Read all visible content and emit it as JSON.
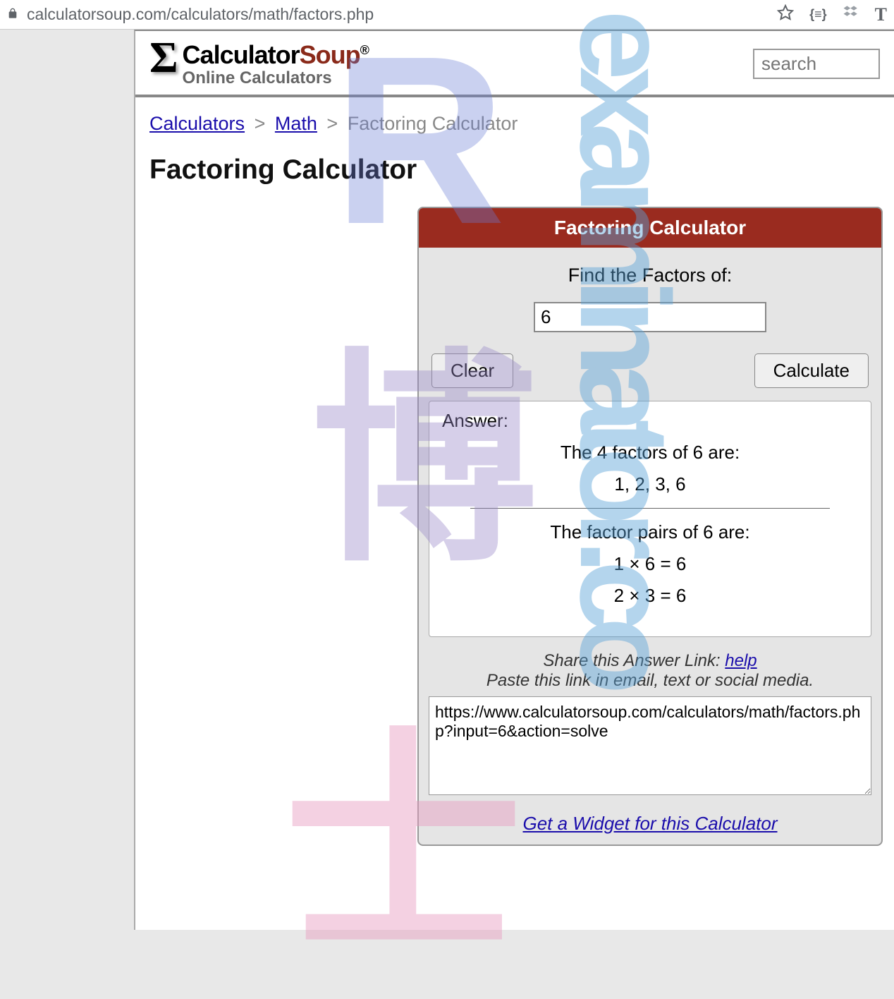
{
  "browser": {
    "url": "calculatorsoup.com/calculators/math/factors.php"
  },
  "header": {
    "brand_calc": "Calculator",
    "brand_soup": "Soup",
    "brand_reg": "®",
    "brand_sub": "Online Calculators",
    "search_placeholder": "search"
  },
  "breadcrumbs": {
    "item1": "Calculators",
    "sep": ">",
    "item2": "Math",
    "current": "Factoring Calculator"
  },
  "page": {
    "title": "Factoring Calculator"
  },
  "calc": {
    "header": "Factoring Calculator",
    "prompt": "Find the Factors of:",
    "input_value": "6",
    "clear_label": "Clear",
    "calculate_label": "Calculate",
    "answer_label": "Answer:",
    "factors_heading": "The 4 factors of 6 are:",
    "factors_list": "1, 2, 3, 6",
    "pairs_heading": "The factor pairs of 6 are:",
    "pair1": "1 × 6 = 6",
    "pair2": "2 × 3 = 6",
    "share_label": "Share this Answer Link: ",
    "help_label": "help",
    "paste_label": "Paste this link in email, text or social media.",
    "share_url": "https://www.calculatorsoup.com/calculators/math/factors.php?input=6&action=solve",
    "widget_label": "Get a Widget for this Calculator"
  },
  "watermarks": {
    "r": "R",
    "exam": "examinator.co",
    "bo": "博",
    "shi": "士"
  }
}
